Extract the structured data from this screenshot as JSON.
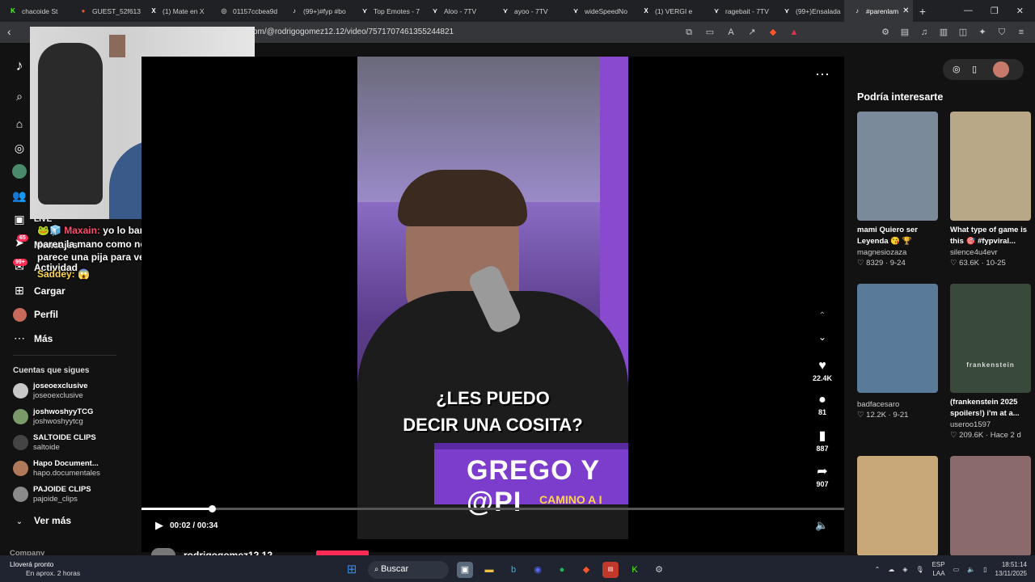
{
  "tabs": [
    {
      "label": "chacoide St",
      "icon": "kick-icon",
      "color": "#53fc18"
    },
    {
      "label": "GUEST_52f613",
      "icon": "patreon-icon",
      "color": "#e05a2a"
    },
    {
      "label": "(1) Mate en X",
      "icon": "x-icon",
      "color": "#ffffff"
    },
    {
      "label": "01157ccbea9d",
      "icon": "web-icon",
      "color": "#aaaaaa"
    },
    {
      "label": "(99+)#fyp #bo",
      "icon": "tiktok-icon",
      "color": "#ffffff"
    },
    {
      "label": "Top Emotes - 7",
      "icon": "7tv-icon",
      "color": "#ffffff"
    },
    {
      "label": "Aloo - 7TV",
      "icon": "7tv-icon",
      "color": "#ffffff"
    },
    {
      "label": "ayoo - 7TV",
      "icon": "7tv-icon",
      "color": "#ffffff"
    },
    {
      "label": "wideSpeedNo",
      "icon": "7tv-icon",
      "color": "#ffffff"
    },
    {
      "label": "(1) VERGI e",
      "icon": "x-icon",
      "color": "#ffffff"
    },
    {
      "label": "ragebait - 7TV",
      "icon": "7tv-icon",
      "color": "#ffffff"
    },
    {
      "label": "(99+)Ensalada",
      "icon": "7tv-icon",
      "color": "#ffffff"
    },
    {
      "label": "#parenlam",
      "icon": "tiktok-icon",
      "color": "#ffffff",
      "active": true
    }
  ],
  "address": {
    "url": "om/@rodrigogomez12.12/video/7571707461355244821"
  },
  "sidebar": {
    "items": [
      {
        "label": "LIVE"
      },
      {
        "label": "Mensajes",
        "badge": "65"
      },
      {
        "label": "Actividad",
        "badge": "99+"
      },
      {
        "label": "Cargar"
      },
      {
        "label": "Perfil"
      },
      {
        "label": "Más"
      }
    ],
    "following_title": "Cuentas que sigues",
    "accounts": [
      {
        "name": "joseoexclusive",
        "handle": "joseoexclusive",
        "color": "#c8c8c8"
      },
      {
        "name": "joshwoshyyTCG",
        "handle": "joshwoshyytcg",
        "color": "#7a9a6a"
      },
      {
        "name": "SALTOIDE CLIPS",
        "handle": "saltoide",
        "color": "#444444"
      },
      {
        "name": "Hapo Document...",
        "handle": "hapo.documentales",
        "color": "#b07a5a"
      },
      {
        "name": "PAJOIDE CLIPS",
        "handle": "pajoide_clips",
        "color": "#8a8a8a"
      }
    ],
    "see_more": "Ver más",
    "company": "Company"
  },
  "chat": {
    "line1_user": "Maxain:",
    "line1_text": "yo lo banque siempre, pero paren la mano como no me gusta el futbol me parece una pija para ver",
    "line2_user": "Saddey:",
    "line2_emote": "😱"
  },
  "video": {
    "caption1": "¿LES PUEDO",
    "caption2": "DECIR UNA COSITA?",
    "banner_text": "GREGO Y @PI",
    "banner_sub": "CAMINO A I",
    "likes": "22.4K",
    "comments": "81",
    "saves": "887",
    "shares": "907",
    "time": "00:02 / 00:34",
    "progress": 0.06,
    "author": "rodrigogomez12.12"
  },
  "recommend": {
    "title": "Podría interesarte",
    "cards": [
      {
        "title": "mami Quiero ser Leyenda 😘 🏆",
        "author": "magnesiozaza",
        "stats": "♡ 8329 · 9-24",
        "color": "#7a8a9a"
      },
      {
        "title": "What type of game is this 🎯 #fypviral...",
        "author": "silence4u4evr",
        "stats": "♡ 63.6K · 10-25",
        "color": "#b8a888"
      },
      {
        "title": "",
        "author": "badfacesaro",
        "stats": "♡ 12.2K · 9-21",
        "color": "#5a7a9a"
      },
      {
        "title": "(frankenstein 2025 spoilers!) i'm at a...",
        "author": "useroo1597",
        "stats": "♡ 209.6K · Hace 2 d",
        "color": "#3a4a3a"
      },
      {
        "title": "",
        "author": "",
        "stats": "",
        "color": "#c8a878"
      },
      {
        "title": "",
        "author": "",
        "stats": "",
        "color": "#8a6a6a"
      }
    ],
    "card4_label": "frankenstein"
  },
  "taskbar": {
    "weather_title": "Lloverá pronto",
    "weather_sub": "En aprox. 2 horas",
    "search": "Buscar",
    "lang1": "ESP",
    "lang2": "LAA",
    "time": "18:51:14",
    "date": "13/11/2025"
  }
}
